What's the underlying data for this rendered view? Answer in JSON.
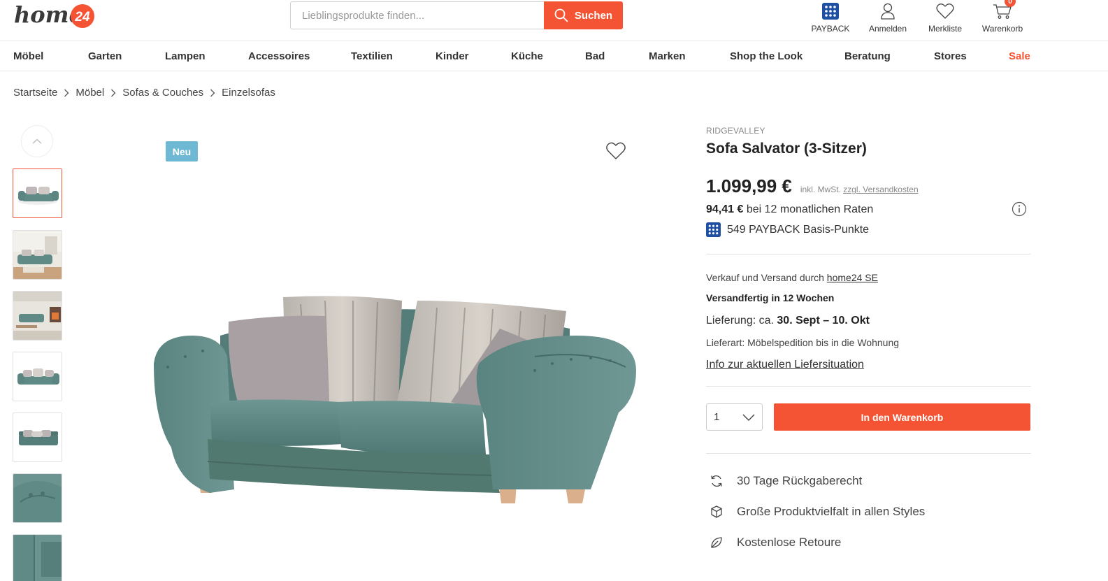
{
  "header": {
    "logo_text_main": "home",
    "logo_text_num": "24",
    "search_placeholder": "Lieblingsprodukte finden...",
    "search_button": "Suchen",
    "icons": [
      {
        "name": "payback-icon",
        "label": "PAYBACK"
      },
      {
        "name": "user-icon",
        "label": "Anmelden"
      },
      {
        "name": "heart-icon",
        "label": "Merkliste"
      },
      {
        "name": "cart-icon",
        "label": "Warenkorb",
        "badge": "0"
      }
    ]
  },
  "nav": [
    "Möbel",
    "Garten",
    "Lampen",
    "Accessoires",
    "Textilien",
    "Kinder",
    "Küche",
    "Bad",
    "Marken",
    "Shop the Look",
    "Beratung",
    "Stores",
    "Sale"
  ],
  "breadcrumb": [
    "Startseite",
    "Möbel",
    "Sofas & Couches",
    "Einzelsofas"
  ],
  "gallery": {
    "badge": "Neu",
    "thumb_count": 7
  },
  "product": {
    "brand": "RIDGEVALLEY",
    "title": "Sofa Salvator (3-Sitzer)",
    "price": "1.099,99 €",
    "price_note": "inkl. MwSt.",
    "shipping_link": "zzgl. Versandkosten",
    "installment_amount": "94,41 €",
    "installment_text": "bei 12 monatlichen Raten",
    "payback_points": "549 PAYBACK Basis-Punkte",
    "seller_prefix": "Verkauf und Versand durch",
    "seller_link": "home24 SE",
    "ready": "Versandfertig in 12 Wochen",
    "delivery_prefix": "Lieferung: ca.",
    "delivery_dates": "30. Sept – 10. Okt",
    "delivery_type": "Lieferart: Möbelspedition bis in die Wohnung",
    "info_link": "Info zur aktuellen Liefersituation",
    "quantity": "1",
    "cart_button": "In den Warenkorb",
    "usps": [
      "30 Tage Rückgaberecht",
      "Große Produktvielfalt in allen Styles",
      "Kostenlose Retoure"
    ]
  },
  "colors": {
    "accent": "#f45334",
    "badge_new": "#6eb8d4",
    "payback_blue": "#1e4fa3",
    "sofa": "#5f8a86"
  }
}
